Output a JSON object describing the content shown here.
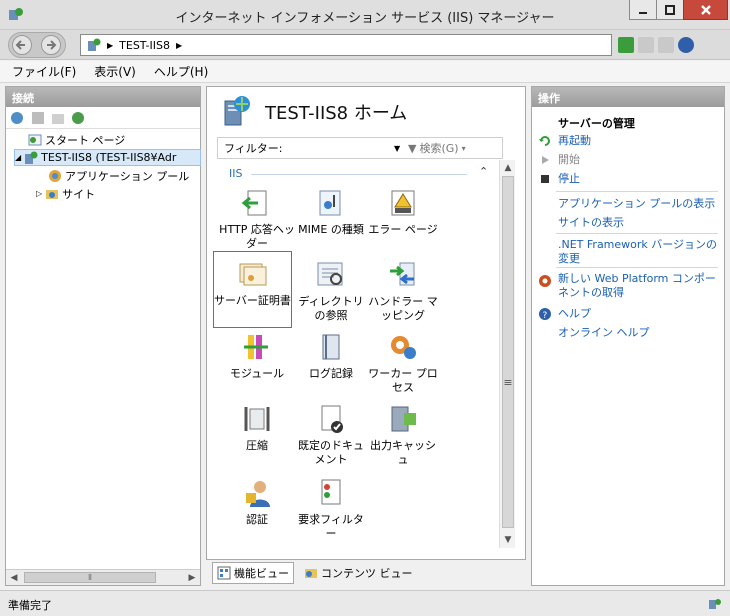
{
  "window": {
    "title": "インターネット インフォメーション サービス (IIS) マネージャー"
  },
  "address": {
    "path": "TEST-IIS8"
  },
  "menu": {
    "items": [
      "ファイル(F)",
      "表示(V)",
      "ヘルプ(H)"
    ]
  },
  "left": {
    "header": "接続",
    "tree": [
      {
        "label": "スタート ページ"
      },
      {
        "label": "TEST-IIS8 (TEST-IIS8¥Adr"
      },
      {
        "label": "アプリケーション プール"
      },
      {
        "label": "サイト"
      }
    ]
  },
  "center": {
    "title": "TEST-IIS8 ホーム",
    "filter_label": "フィルター:",
    "search_label": "検索(G)",
    "group": "IIS",
    "features": [
      {
        "label": "HTTP 応答ヘッダー"
      },
      {
        "label": "MIME の種類"
      },
      {
        "label": "エラー ページ"
      },
      {
        "label": "サーバー証明書"
      },
      {
        "label": "ディレクトリの参照"
      },
      {
        "label": "ハンドラー マッピング"
      },
      {
        "label": "モジュール"
      },
      {
        "label": "ログ記録"
      },
      {
        "label": "ワーカー プロセス"
      },
      {
        "label": "圧縮"
      },
      {
        "label": "既定のドキュメント"
      },
      {
        "label": "出力キャッシュ"
      },
      {
        "label": "認証"
      },
      {
        "label": "要求フィルター"
      }
    ],
    "tabs": [
      "機能ビュー",
      "コンテンツ ビュー"
    ]
  },
  "right": {
    "header": "操作",
    "server_section": "サーバーの管理",
    "actions": {
      "restart": "再起動",
      "start": "開始",
      "stop": "停止",
      "view_pools": "アプリケーション プールの表示",
      "view_sites": "サイトの表示",
      "net_version": ".NET Framework バージョンの変更",
      "web_platform": "新しい Web Platform コンポーネントの取得",
      "help": "ヘルプ",
      "online_help": "オンライン ヘルプ"
    }
  },
  "status": {
    "text": "準備完了"
  },
  "colors": {
    "link": "#1a5fb4",
    "selection": "#e0423a",
    "header": "#9c9c9c"
  }
}
